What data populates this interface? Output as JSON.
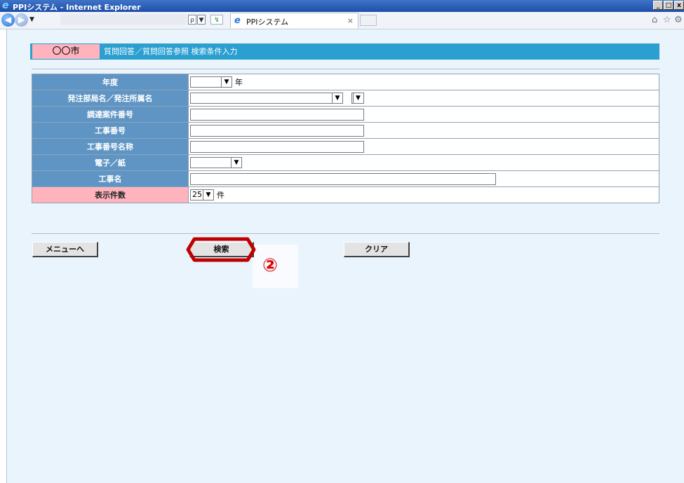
{
  "window": {
    "title": "PPIシステム - Internet Explorer",
    "controls": [
      "_",
      "□",
      "x"
    ]
  },
  "browser": {
    "dropdown_glyph": "▼",
    "addr_search": "ρ",
    "addr_drop": "▼",
    "addr_refresh": "↯",
    "tab_label": "PPIシステム",
    "tab_close": "×",
    "icons": [
      "home-icon",
      "star-icon",
      "gear-icon"
    ],
    "home": "⌂",
    "star": "☆",
    "gear": "⚙"
  },
  "header": {
    "city": "〇〇市",
    "breadcrumb": "質問回答／質問回答参照 検索条件入力"
  },
  "form": {
    "year_label": "年度",
    "year_unit": "年",
    "dept_label": "発注部局名／発注所属名",
    "case_label": "調達案件番号",
    "work_no_label": "工事番号",
    "work_no_name_label": "工事番号名称",
    "media_label": "電子／紙",
    "work_name_label": "工事名",
    "count_label": "表示件数",
    "count_value": "25",
    "count_unit": "件"
  },
  "buttons": {
    "menu": "メニューへ",
    "search": "検索",
    "clear": "クリア"
  },
  "annotation": {
    "step": "②",
    "highlight_color": "#c00000"
  },
  "colors": {
    "header_bar": "#2a9fd0",
    "city_badge": "#ffb3bd",
    "label_cell": "#5f95c4",
    "page_bg": "#eaf4fd"
  }
}
